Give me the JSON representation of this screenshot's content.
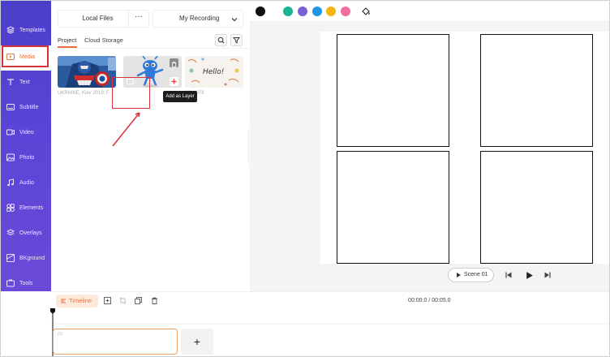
{
  "sidebar": {
    "items": [
      {
        "label": "Templates",
        "icon": "templates-icon"
      },
      {
        "label": "Media",
        "icon": "media-icon"
      },
      {
        "label": "Text",
        "icon": "text-icon"
      },
      {
        "label": "Subtitle",
        "icon": "subtitle-icon"
      },
      {
        "label": "Video",
        "icon": "video-icon"
      },
      {
        "label": "Photo",
        "icon": "photo-icon"
      },
      {
        "label": "Audio",
        "icon": "audio-icon"
      },
      {
        "label": "Elements",
        "icon": "elements-icon"
      },
      {
        "label": "Overlays",
        "icon": "overlays-icon"
      },
      {
        "label": "BKground",
        "icon": "background-icon"
      },
      {
        "label": "Tools",
        "icon": "tools-icon"
      }
    ],
    "active": "Media"
  },
  "media": {
    "local_files": "Local Files",
    "more": "···",
    "recording": "My Recording",
    "tabs": [
      "Project",
      "Cloud Storage"
    ],
    "active_tab": "Project",
    "thumbs": [
      {
        "caption": "UKRAINE, Kiev 2019: F"
      },
      {
        "caption": ""
      },
      {
        "caption": "3644073"
      }
    ],
    "tooltip": "Add as Layer"
  },
  "toolbar": {
    "colors": [
      "#111111",
      "#ffffff",
      "#19b394",
      "#7b61d6",
      "#1f93e8",
      "#f5b614",
      "#ef6ea0"
    ]
  },
  "player": {
    "scene": "Scene 01"
  },
  "timeline": {
    "label": "Timeline",
    "timecode": "00:00.0 / 00:05.0",
    "track_label": "(0)",
    "add": "+"
  },
  "colors": {
    "accent": "#e8733a",
    "sidebar": "#5a45d6",
    "highlight": "#d6333a"
  }
}
